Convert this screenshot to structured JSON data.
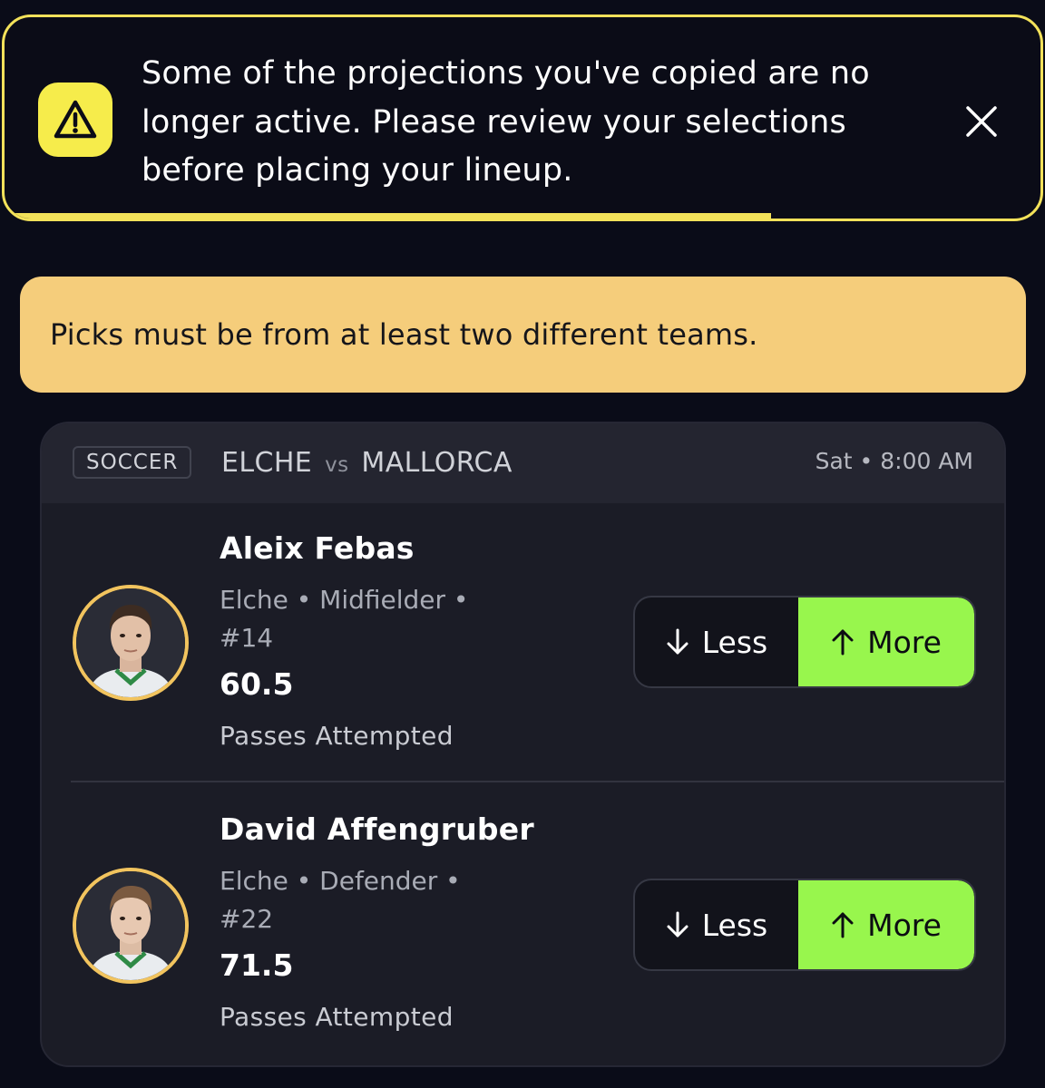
{
  "alert": {
    "message": "Some of the projections you've copied are no longer active. Please review your selections before placing your lineup.",
    "icon": "warning-icon",
    "close_icon": "close-icon",
    "progress": 0.74,
    "accent_color": "#f3e25a"
  },
  "warning": {
    "message": "Picks must be from at least two different teams.",
    "background": "#f5cd7b"
  },
  "match": {
    "sport": "SOCCER",
    "home": "ELCHE",
    "vs": "vs",
    "away": "MALLORCA",
    "time": "Sat • 8:00 AM"
  },
  "players": [
    {
      "name": "Aleix Febas",
      "meta": "Elche • Midfielder • #14",
      "line": "60.5",
      "stat": "Passes Attempted",
      "less_label": "Less",
      "more_label": "More",
      "selected": "More"
    },
    {
      "name": "David Affengruber",
      "meta": "Elche • Defender • #22",
      "line": "71.5",
      "stat": "Passes Attempted",
      "less_label": "Less",
      "more_label": "More",
      "selected": "More"
    }
  ],
  "colors": {
    "more_selected": "#98f64d",
    "avatar_ring": "#f2c45e"
  }
}
